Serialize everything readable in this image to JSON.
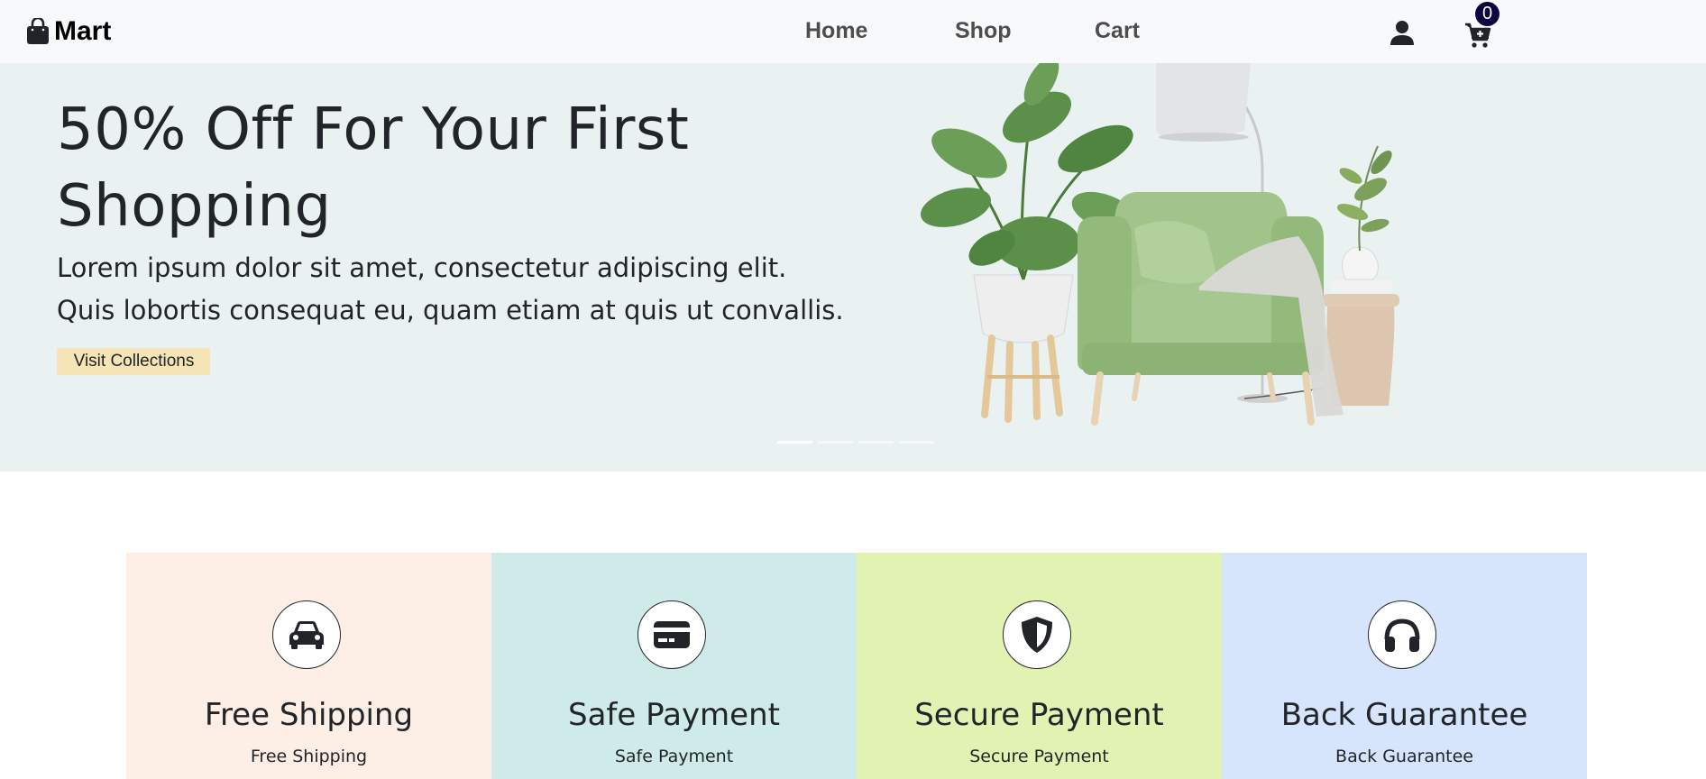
{
  "navbar": {
    "brand": "Mart",
    "brand_icon": "shopping-bag-icon",
    "links": [
      "Home",
      "Shop",
      "Cart"
    ],
    "user_icon": "user-icon",
    "cart_icon": "cart-plus-icon",
    "cart_count": "0"
  },
  "hero": {
    "title": "50% Off For Your First Shopping",
    "description": "Lorem ipsum dolor sit amet, consectetur adipiscing elit. Quis lobortis consequat eu, quam etiam at quis ut convallis.",
    "button": "Visit Collections",
    "image": "armchair-with-plants-and-lamp",
    "slides": 4,
    "active_slide": 1,
    "background": "#eaf2f1",
    "button_color": "#f5e4b5"
  },
  "features": [
    {
      "title": "Free Shipping",
      "subtitle": "Free Shipping",
      "icon": "car-icon",
      "color": "#fdefe6"
    },
    {
      "title": "Safe Payment",
      "subtitle": "Safe Payment",
      "icon": "credit-card-icon",
      "color": "#ceebe9"
    },
    {
      "title": "Secure Payment",
      "subtitle": "Secure Payment",
      "icon": "shield-icon",
      "color": "#e2f2b2"
    },
    {
      "title": "Back Guarantee",
      "subtitle": "Back Guarantee",
      "icon": "headphones-icon",
      "color": "#d6e5fb"
    }
  ]
}
